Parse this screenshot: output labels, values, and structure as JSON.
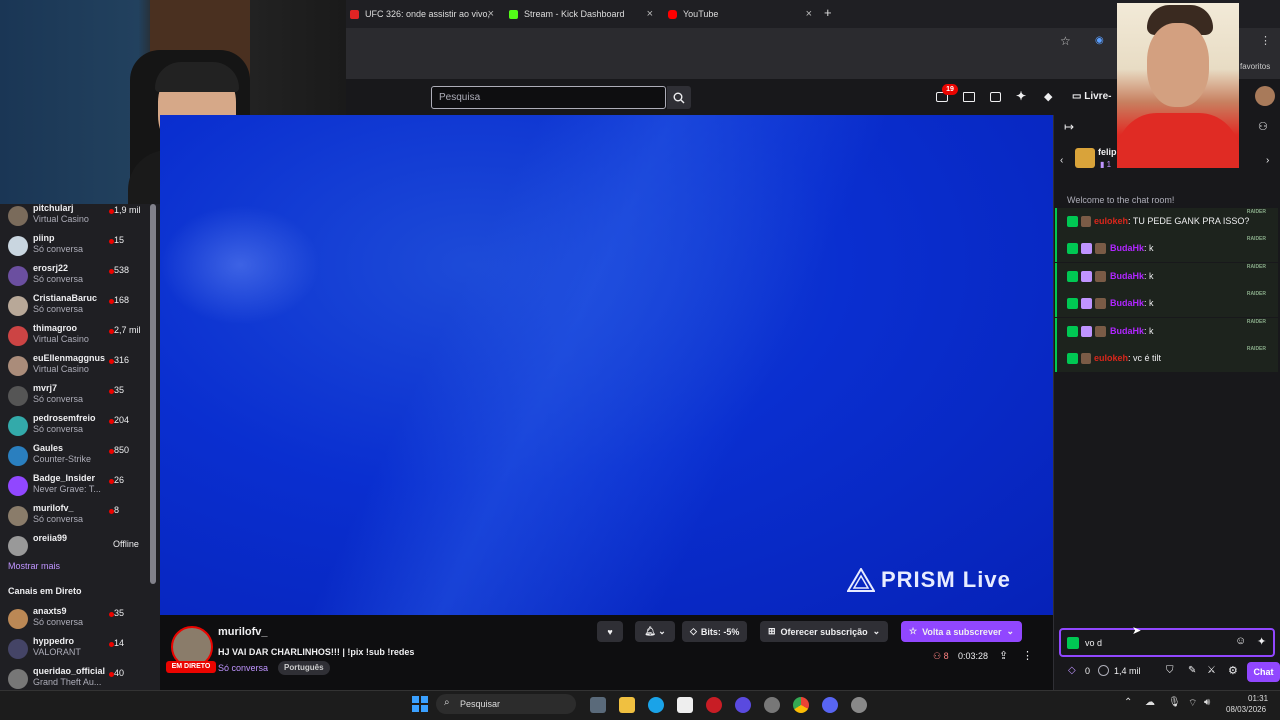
{
  "browser": {
    "tabs": [
      {
        "label": "UFC 326: onde assistir ao vivo,",
        "color": "#e02424"
      },
      {
        "label": "Stream - Kick Dashboard",
        "color": "#53fc18"
      },
      {
        "label": "YouTube",
        "color": "#ff0000"
      }
    ],
    "new_tab": "+",
    "bookmarks_label": "favoritos"
  },
  "topnav": {
    "search_placeholder": "Pesquisa",
    "notifications_count": "19",
    "prime_label": "Livre-"
  },
  "sidebar": {
    "channels": [
      {
        "name": "pitchularj",
        "game": "Virtual Casino",
        "viewers": "1,9 mil",
        "color": "#7a6b5b"
      },
      {
        "name": "piinp",
        "game": "Só conversa",
        "viewers": "15",
        "color": "#c9d6e0"
      },
      {
        "name": "erosrj22",
        "game": "Só conversa",
        "viewers": "538",
        "color": "#6b4fa0"
      },
      {
        "name": "CristianaBaruc",
        "game": "Só conversa",
        "viewers": "168",
        "color": "#b8a898"
      },
      {
        "name": "thimagroo",
        "game": "Virtual Casino",
        "viewers": "2,7 mil",
        "color": "#c44"
      },
      {
        "name": "euEllenmaggnus",
        "game": "Virtual Casino",
        "viewers": "316",
        "color": "#aa8c7a"
      },
      {
        "name": "mvrj7",
        "game": "Só conversa",
        "viewers": "35",
        "color": "#555"
      },
      {
        "name": "pedrosemfreio",
        "game": "Só conversa",
        "viewers": "204",
        "color": "#3aa"
      },
      {
        "name": "Gaules",
        "game": "Counter-Strike",
        "viewers": "850",
        "color": "#2a7fbf"
      },
      {
        "name": "Badge_Insider",
        "game": "Never Grave: T...",
        "viewers": "26",
        "color": "#9147ff"
      },
      {
        "name": "murilofv_",
        "game": "Só conversa",
        "viewers": "8",
        "color": "#8a7c6a"
      },
      {
        "name": "oreiia99",
        "game": "",
        "viewers": "Offline",
        "color": "#999"
      }
    ],
    "show_more": "Mostrar mais",
    "live_section": "Canais em Direto",
    "live_channels": [
      {
        "name": "anaxts9",
        "game": "Só conversa",
        "viewers": "35",
        "color": "#b85"
      },
      {
        "name": "hyppedro",
        "game": "VALORANT",
        "viewers": "14",
        "color": "#446"
      },
      {
        "name": "queridao_official",
        "game": "Grand Theft Au...",
        "viewers": "40",
        "color": "#777"
      }
    ]
  },
  "video": {
    "watermark": "PRISM Live"
  },
  "stream_info": {
    "channel": "murilofv_",
    "title": "HJ VAI DAR CHARLINHOS!!! | !pix !sub !redes",
    "live_badge": "EM DIRETO",
    "category": "Só conversa",
    "tag": "Português",
    "bits_label": "Bits: -5%",
    "gift_sub_label": "Oferecer subscrição",
    "resub_label": "Volta a subscrever",
    "viewers": "8",
    "uptime": "0:03:28"
  },
  "chat": {
    "welcome": "Welcome to the chat room!",
    "gift_user": "felip",
    "gift_count": "1",
    "raider_tag": "RAIDER",
    "messages": [
      {
        "user": "eulokeh",
        "text": ": TU PEDE GANK PRA ISSO?",
        "color": "#d8261b",
        "sub": false
      },
      {
        "user": "BudaHk",
        "text": ": k",
        "color": "#b026ff",
        "sub": true
      },
      {
        "user": "BudaHk",
        "text": ": k",
        "color": "#b026ff",
        "sub": true
      },
      {
        "user": "BudaHk",
        "text": ": k",
        "color": "#b026ff",
        "sub": true
      },
      {
        "user": "BudaHk",
        "text": ": k",
        "color": "#b026ff",
        "sub": true
      },
      {
        "user": "eulokeh",
        "text": ": vc é tilt",
        "color": "#d8261b",
        "sub": false
      }
    ],
    "input_value": "vo d",
    "points_count": "0",
    "channel_points": "1,4 mil",
    "chat_button": "Chat"
  },
  "taskbar": {
    "search_label": "Pesquisar",
    "time": "01:31",
    "date": "08/03/2026"
  },
  "colors": {
    "accent": "#9147ff",
    "live_red": "#eb0400",
    "chat_green": "#00c853"
  }
}
